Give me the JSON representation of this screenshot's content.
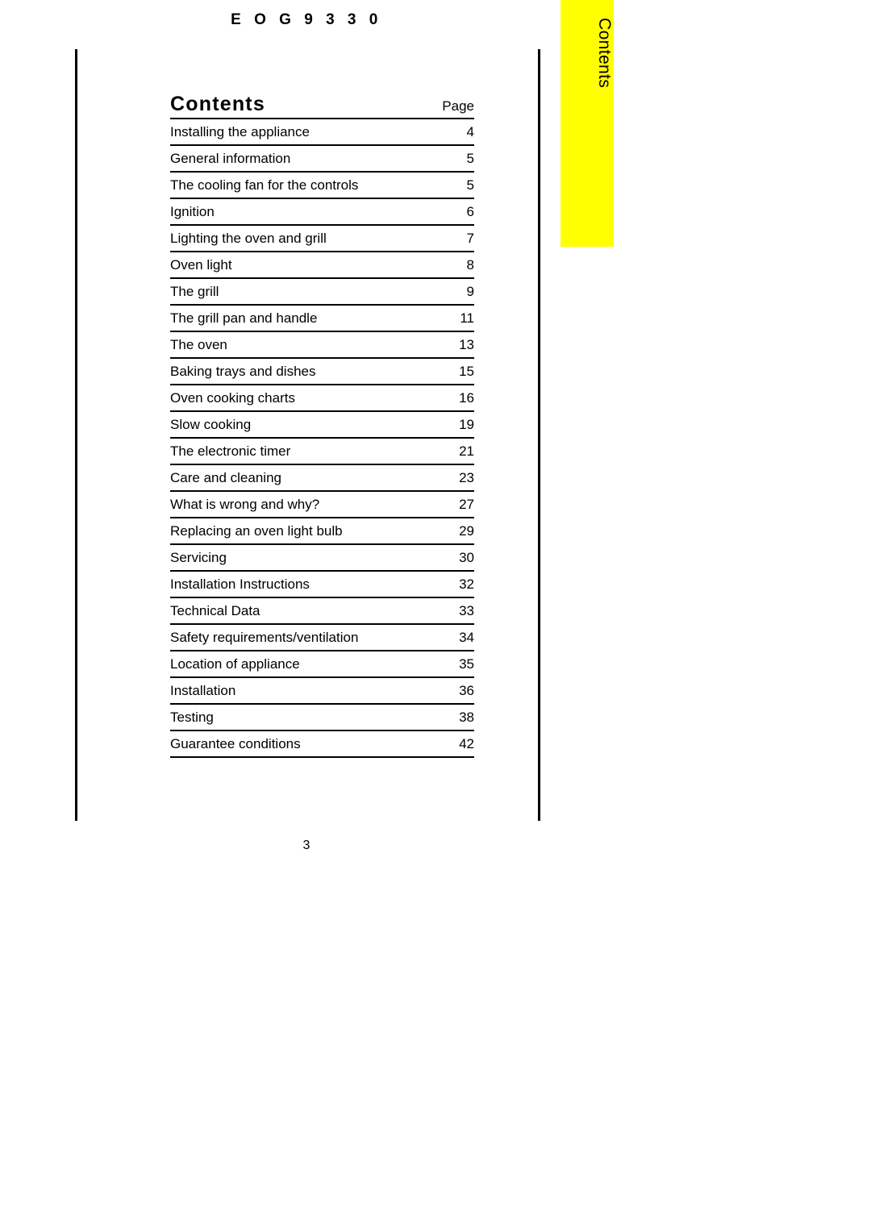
{
  "header": {
    "model": "E O G  9 3 3 0"
  },
  "thumb_tab": {
    "label": "Contents",
    "color": "#ffff00"
  },
  "contents": {
    "title": "Contents",
    "page_column_header": "Page",
    "entries": [
      {
        "title": "Installing the appliance",
        "page": "4"
      },
      {
        "title": "General information",
        "page": "5"
      },
      {
        "title": "The cooling fan for the controls",
        "page": "5"
      },
      {
        "title": "Ignition",
        "page": "6"
      },
      {
        "title": "Lighting the oven and grill",
        "page": "7"
      },
      {
        "title": "Oven light",
        "page": "8"
      },
      {
        "title": "The grill",
        "page": "9"
      },
      {
        "title": "The grill pan and handle",
        "page": "11"
      },
      {
        "title": "The oven",
        "page": "13"
      },
      {
        "title": "Baking trays and dishes",
        "page": "15"
      },
      {
        "title": "Oven cooking charts",
        "page": "16"
      },
      {
        "title": "Slow cooking",
        "page": "19"
      },
      {
        "title": "The electronic timer",
        "page": "21"
      },
      {
        "title": "Care and cleaning",
        "page": "23"
      },
      {
        "title": "What is wrong and why?",
        "page": "27"
      },
      {
        "title": "Replacing an oven light bulb",
        "page": "29"
      },
      {
        "title": "Servicing",
        "page": "30"
      },
      {
        "title": "Installation Instructions",
        "page": "32"
      },
      {
        "title": "Technical Data",
        "page": "33"
      },
      {
        "title": "Safety requirements/ventilation",
        "page": "34"
      },
      {
        "title": "Location of appliance",
        "page": "35"
      },
      {
        "title": "Installation",
        "page": "36"
      },
      {
        "title": "Testing",
        "page": "38"
      },
      {
        "title": "Guarantee conditions",
        "page": "42"
      }
    ]
  },
  "folio": {
    "page_number": "3"
  }
}
